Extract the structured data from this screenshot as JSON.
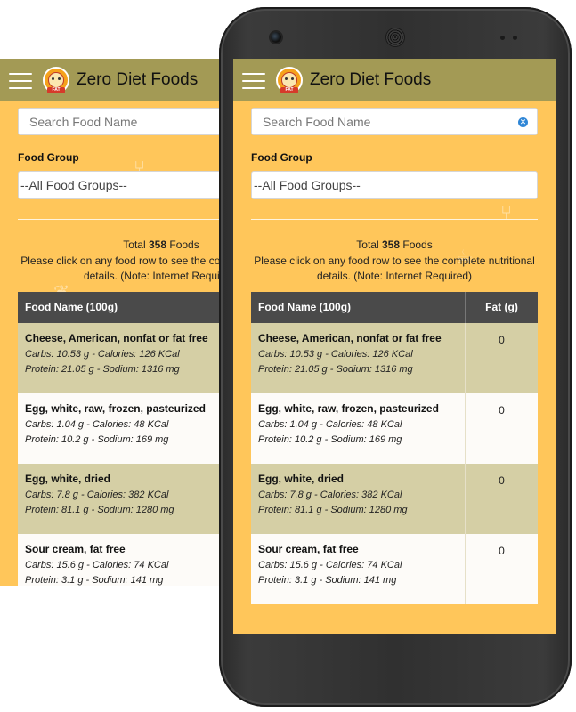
{
  "app": {
    "title": "Zero Diet Foods",
    "logo_ribbon": "FAT",
    "appbar_color": "#a39a55",
    "background_color": "#ffc65a"
  },
  "search": {
    "placeholder": "Search Food Name",
    "value": ""
  },
  "food_group": {
    "label": "Food Group",
    "selected": "--All Food Groups--"
  },
  "summary": {
    "total_prefix": "Total",
    "total_count": "358",
    "total_suffix": "Foods",
    "note": "Please click on any food row to see the complete nutritional details. (Note: Internet Required)"
  },
  "table": {
    "headers": {
      "name": "Food Name (100g)",
      "fat": "Fat (g)"
    },
    "rows": [
      {
        "name": "Cheese, American, nonfat or fat free",
        "line1": "Carbs: 10.53 g - Calories: 126 KCal",
        "line2": "Protein: 21.05 g - Sodium: 1316 mg",
        "fat": "0"
      },
      {
        "name": "Egg, white, raw, frozen, pasteurized",
        "line1": "Carbs: 1.04 g - Calories: 48 KCal",
        "line2": "Protein: 10.2 g - Sodium: 169 mg",
        "fat": "0"
      },
      {
        "name": "Egg, white, dried",
        "line1": "Carbs: 7.8 g - Calories: 382 KCal",
        "line2": "Protein: 81.1 g - Sodium: 1280 mg",
        "fat": "0"
      },
      {
        "name": "Sour cream, fat free",
        "line1": "Carbs: 15.6 g - Calories: 74 KCal",
        "line2": "Protein: 3.1 g - Sodium: 141 mg",
        "fat": "0"
      }
    ]
  },
  "icons": {
    "menu": "hamburger-icon",
    "clear": "clear-search-icon",
    "logo": "app-logo-icon"
  }
}
